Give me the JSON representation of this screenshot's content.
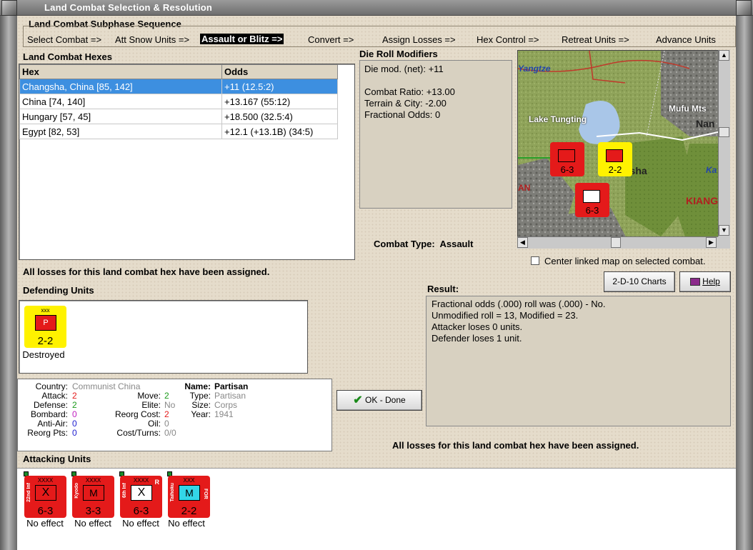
{
  "window": {
    "title": "Land Combat Selection & Resolution"
  },
  "sequence": {
    "title": "Land Combat Subphase Sequence",
    "steps": [
      "Select Combat =>",
      "Att Snow Units =>",
      "Assault or Blitz =>",
      "Convert =>",
      "Assign Losses =>",
      "Hex Control =>",
      "Retreat Units =>",
      "Advance Units"
    ],
    "active_index": 2
  },
  "hexes": {
    "title": "Land Combat Hexes",
    "columns": [
      "Hex",
      "Odds"
    ],
    "rows": [
      {
        "hex": "Changsha, China [85, 142]",
        "odds": "+11 (12.5:2)"
      },
      {
        "hex": "China [74, 140]",
        "odds": "+13.167 (55:12)"
      },
      {
        "hex": "Hungary [57, 45]",
        "odds": "+18.500 (32.5:4)"
      },
      {
        "hex": "Egypt [82, 53]",
        "odds": "+12.1 (+13.1B) (34:5)"
      }
    ],
    "selected_index": 0
  },
  "modifiers": {
    "title": "Die Roll Modifiers",
    "lines": [
      "Die mod. (net): +11",
      "",
      "Combat Ratio: +13.00",
      "Terrain & City: -2.00",
      "Fractional Odds: 0"
    ]
  },
  "map": {
    "labels": [
      "Yangtze",
      "Lake Tungting",
      "Mufu Mts",
      "Nan",
      "gsha",
      "Ka",
      "KIANG",
      "AN"
    ],
    "center_checkbox_label": "Center linked map on selected combat.",
    "center_checked": false
  },
  "combat_type": {
    "label": "Combat Type:",
    "value": "Assault"
  },
  "losses_message": "All losses for this land combat hex have been assigned.",
  "buttons": {
    "charts": "2-D-10 Charts",
    "help": "Help",
    "ok": "OK - Done"
  },
  "defending": {
    "title": "Defending Units",
    "units": [
      {
        "size": "xxx",
        "symbol": "P",
        "value": "2-2",
        "status": "Destroyed"
      }
    ]
  },
  "unit_info": {
    "country_label": "Country:",
    "country": "Communist China",
    "attack_label": "Attack:",
    "attack": "2",
    "defense_label": "Defense:",
    "defense": "2",
    "bombard_label": "Bombard:",
    "bombard": "0",
    "antiair_label": "Anti-Air:",
    "antiair": "0",
    "reorgpts_label": "Reorg Pts:",
    "reorgpts": "0",
    "move_label": "Move:",
    "move": "2",
    "elite_label": "Elite:",
    "elite": "No",
    "reorgcost_label": "Reorg Cost:",
    "reorgcost": "2",
    "oil_label": "Oil:",
    "oil": "0",
    "costturns_label": "Cost/Turns:",
    "costturns": "0/0",
    "name_label": "Name:",
    "name": "Partisan",
    "type_label": "Type:",
    "type": "Partisan",
    "size_label": "Size:",
    "size": "Corps",
    "year_label": "Year:",
    "year": "1941"
  },
  "result": {
    "title": "Result:",
    "lines": [
      "Fractional odds (.000) roll was (.000)  - No.",
      "Unmodified roll = 13, Modified = 23.",
      "Attacker loses 0 units.",
      "Defender loses 1 unit."
    ],
    "footer": "All losses for this land combat hex have been assigned."
  },
  "attacking": {
    "title": "Attacking Units",
    "units": [
      {
        "size": "XXXX",
        "side": "22nd Inf",
        "rside": "",
        "badge": "",
        "symbol": "X",
        "value": "6-3",
        "status": "No effect",
        "sym_color": "#e41a1a"
      },
      {
        "size": "XXXX",
        "side": "Kyodo",
        "rside": "",
        "badge": "",
        "symbol": "M",
        "value": "3-3",
        "status": "No effect",
        "sym_color": "#e41a1a"
      },
      {
        "size": "XXXX",
        "side": "6th Inf",
        "rside": "",
        "badge": "R",
        "symbol": "X",
        "value": "6-3",
        "status": "No effect",
        "sym_color": "#ffffff"
      },
      {
        "size": "XXX",
        "side": "Taihoku",
        "rside": "FOR",
        "badge": "",
        "symbol": "M",
        "value": "2-2",
        "status": "No effect",
        "sym_color": "#33d6e8"
      }
    ]
  },
  "colors": {
    "selected_row": "#3d8fe0",
    "unit_red": "#e41a1a",
    "unit_yellow": "#fff200",
    "attack_val": "#e41a1a",
    "defense_val": "#1a9a1a",
    "bombard_val": "#c020c0",
    "antiair_val": "#2020d0",
    "move_val": "#1a9a1a",
    "reorgcost_val": "#e41a1a"
  }
}
